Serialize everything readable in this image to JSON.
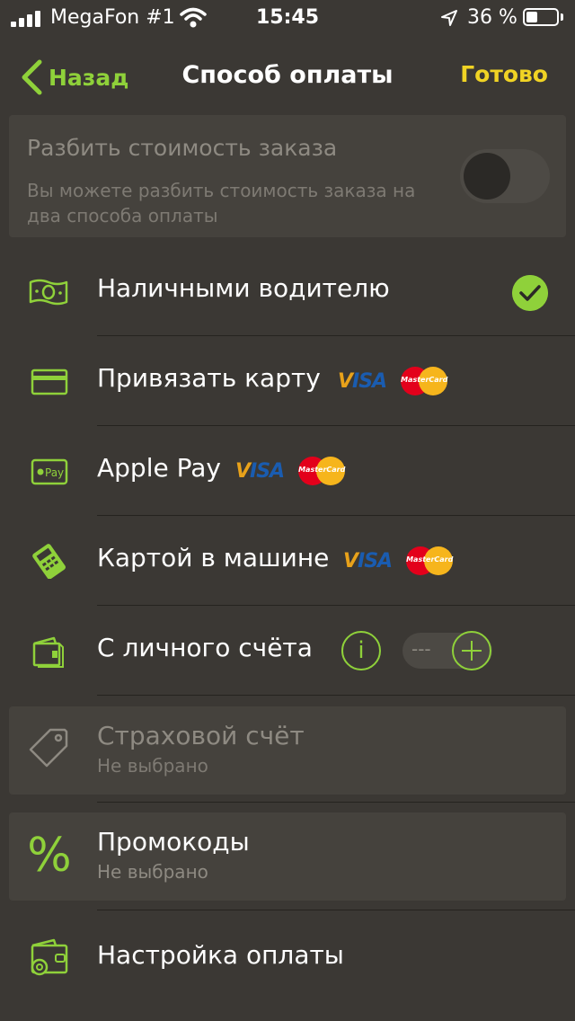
{
  "status_bar": {
    "carrier": "MegaFon #1",
    "time": "15:45",
    "battery_text": "36 %",
    "battery_level": 0.36
  },
  "nav": {
    "back_label": "Назад",
    "title": "Способ оплаты",
    "done_label": "Готово"
  },
  "split": {
    "title": "Разбить стоимость заказа",
    "description": "Вы можете разбить стоимость заказа на два способа оплаты",
    "enabled": false
  },
  "methods": [
    {
      "label": "Наличными водителю",
      "icon": "cash-icon",
      "selected": true
    },
    {
      "label": "Привязать карту",
      "icon": "credit-card-icon",
      "badges": [
        "VISA",
        "MasterCard"
      ]
    },
    {
      "label": "Apple Pay",
      "icon": "apple-pay-icon",
      "icon_text": "Pay",
      "badges": [
        "VISA",
        "MasterCard"
      ]
    },
    {
      "label": "Картой в машине",
      "icon": "card-terminal-icon",
      "badges": [
        "VISA",
        "MasterCard"
      ]
    },
    {
      "label": "С личного счёта",
      "icon": "wallet-account-icon",
      "info_label": "i",
      "balance_value": "---"
    }
  ],
  "badges": {
    "visa": "VISA",
    "mastercard": "MasterCard"
  },
  "insurance": {
    "label": "Страховой счёт",
    "sublabel": "Не выбрано",
    "icon": "tag-icon"
  },
  "promo": {
    "label": "Промокоды",
    "sublabel": "Не выбрано",
    "icon": "percent-icon",
    "icon_text": "%"
  },
  "settings": {
    "label": "Настройка оплаты",
    "icon": "wallet-gear-icon"
  },
  "colors": {
    "background": "#3b3834",
    "accent_green": "#8fd13a",
    "done_yellow": "#f0d324",
    "panel": "#45423d",
    "muted_text": "#8e8a82"
  }
}
